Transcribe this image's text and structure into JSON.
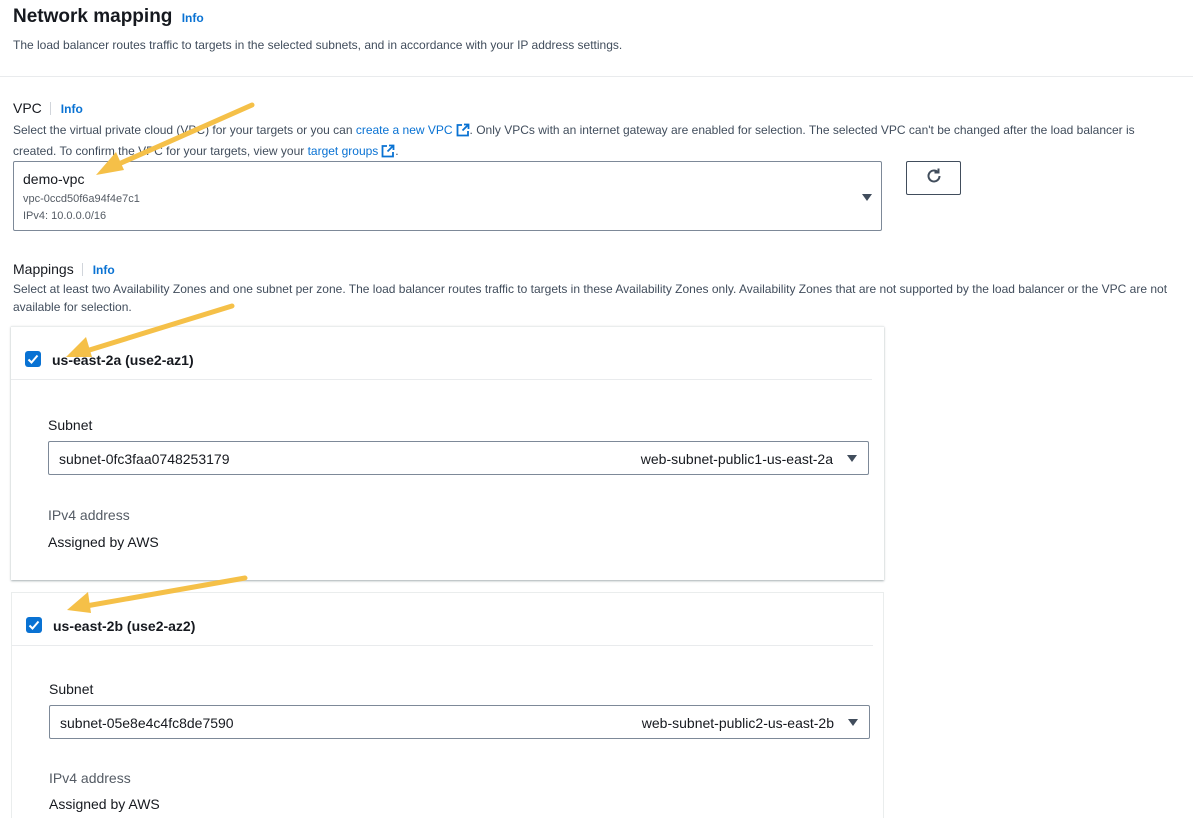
{
  "header": {
    "title": "Network mapping",
    "info": "Info",
    "description": "The load balancer routes traffic to targets in the selected subnets, and in accordance with your IP address settings."
  },
  "vpc": {
    "label": "VPC",
    "info": "Info",
    "desc_part1": "Select the virtual private cloud (VPC) for your targets or you can ",
    "create_link": "create a new VPC",
    "desc_part2": ". Only VPCs with an internet gateway are enabled for selection. The selected VPC can't be changed after the load balancer is created. To confirm the VPC for your targets, view your ",
    "target_link": "target groups",
    "desc_part3": ".",
    "selected_name": "demo-vpc",
    "selected_id": "vpc-0ccd50f6a94f4e7c1",
    "selected_cidr": "IPv4: 10.0.0.0/16"
  },
  "mappings": {
    "label": "Mappings",
    "info": "Info",
    "description": "Select at least two Availability Zones and one subnet per zone. The load balancer routes traffic to targets in these Availability Zones only. Availability Zones that are not supported by the load balancer or the VPC are not available for selection.",
    "zones": [
      {
        "label": "us-east-2a (use2-az1)",
        "checked": true,
        "subnet_label": "Subnet",
        "subnet_id": "subnet-0fc3faa0748253179",
        "subnet_name": "web-subnet-public1-us-east-2a",
        "ipv4_label": "IPv4 address",
        "ipv4_value": "Assigned by AWS"
      },
      {
        "label": "us-east-2b (use2-az2)",
        "checked": true,
        "subnet_label": "Subnet",
        "subnet_id": "subnet-05e8e4c4fc8de7590",
        "subnet_name": "web-subnet-public2-us-east-2b",
        "ipv4_label": "IPv4 address",
        "ipv4_value": "Assigned by AWS"
      }
    ]
  },
  "colors": {
    "link": "#0972d3",
    "annotation_arrow": "#f5c048"
  }
}
